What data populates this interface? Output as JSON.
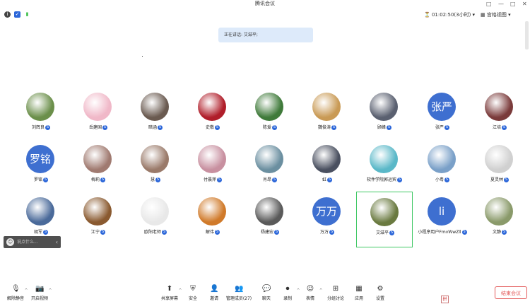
{
  "window": {
    "title": "腾讯会议",
    "controls": [
      "□",
      "—",
      "□",
      "✕"
    ]
  },
  "topbar": {
    "timer": "01:02:50(3小时)",
    "view_label": "宫格视图"
  },
  "speaking": "正在讲话: 艾滋平;",
  "participants": [
    {
      "name": "刘辉良",
      "avatar": "photo",
      "color": "#6b8f4a"
    },
    {
      "name": "岳建国",
      "avatar": "photo",
      "color": "#f0b8c8"
    },
    {
      "name": "暗涵",
      "avatar": "photo",
      "color": "#6a5a50"
    },
    {
      "name": "史敬",
      "avatar": "photo",
      "color": "#b01e2a"
    },
    {
      "name": "陈爱",
      "avatar": "photo",
      "color": "#3f7a3a"
    },
    {
      "name": "魏俊涛",
      "avatar": "photo",
      "color": "#c99a55"
    },
    {
      "name": "顾峰",
      "avatar": "photo",
      "color": "#5a6070"
    },
    {
      "name": "张严",
      "avatar": "text",
      "text": "张严"
    },
    {
      "name": "江培",
      "avatar": "photo",
      "color": "#7a3a3a"
    },
    {
      "name": "罗铭",
      "avatar": "text",
      "text": "罗铭"
    },
    {
      "name": "梅莉",
      "avatar": "photo",
      "color": "#a07a70"
    },
    {
      "name": "慧",
      "avatar": "photo",
      "color": "#9a7a6a"
    },
    {
      "name": "付晨萍",
      "avatar": "photo",
      "color": "#c890a0"
    },
    {
      "name": "肖昂",
      "avatar": "photo",
      "color": "#6b8fa0"
    },
    {
      "name": "虹",
      "avatar": "photo",
      "color": "#4a5060"
    },
    {
      "name": "软件学院郭运宾",
      "avatar": "photo",
      "color": "#5ab8c8"
    },
    {
      "name": "小粤",
      "avatar": "photo",
      "color": "#7aa0c8"
    },
    {
      "name": "夏灵林",
      "avatar": "photo",
      "color": "#d0d0d0"
    },
    {
      "name": "胡军",
      "avatar": "photo",
      "color": "#4a6a9a"
    },
    {
      "name": "江宁",
      "avatar": "photo",
      "color": "#8a5a30"
    },
    {
      "name": "欧阳老师",
      "avatar": "photo",
      "color": "#e8e8e8"
    },
    {
      "name": "解伟",
      "avatar": "photo",
      "color": "#d07a2a"
    },
    {
      "name": "杨建宏",
      "avatar": "photo",
      "color": "#5a5a5a"
    },
    {
      "name": "万万",
      "avatar": "text",
      "text": "万万"
    },
    {
      "name": "艾滋平",
      "avatar": "photo",
      "color": "#6a7a40",
      "active": true
    },
    {
      "name": "小程序用户FmvWwZll",
      "avatar": "text",
      "text": "li"
    },
    {
      "name": "文静",
      "avatar": "photo",
      "color": "#8a9a6a"
    }
  ],
  "chat": {
    "placeholder": "说点什么...",
    "arrow": "‹"
  },
  "toolbar": [
    {
      "label": "解除静音",
      "icon": "mic-muted-icon",
      "glyph": "🎙",
      "caret": true
    },
    {
      "label": "开启视频",
      "icon": "camera-off-icon",
      "glyph": "📷",
      "caret": true
    },
    {
      "label": "共享屏幕",
      "icon": "share-screen-icon",
      "glyph": "⬆",
      "caret": true
    },
    {
      "label": "安全",
      "icon": "shield-icon",
      "glyph": "⛨"
    },
    {
      "label": "邀请",
      "icon": "invite-icon",
      "glyph": "👤"
    },
    {
      "label": "管理成员(27)",
      "icon": "members-icon",
      "glyph": "👥"
    },
    {
      "label": "聊天",
      "icon": "chat-icon",
      "glyph": "💬"
    },
    {
      "label": "录制",
      "icon": "record-icon",
      "glyph": "⏺",
      "caret": true
    },
    {
      "label": "表情",
      "icon": "emoji-icon",
      "glyph": "☺",
      "caret": true
    },
    {
      "label": "分组讨论",
      "icon": "breakout-icon",
      "glyph": "⊞"
    },
    {
      "label": "应用",
      "icon": "apps-icon",
      "glyph": "▦"
    },
    {
      "label": "设置",
      "icon": "gear-icon",
      "glyph": "⚙"
    }
  ],
  "end_button": "结束会议",
  "ime": "拼"
}
